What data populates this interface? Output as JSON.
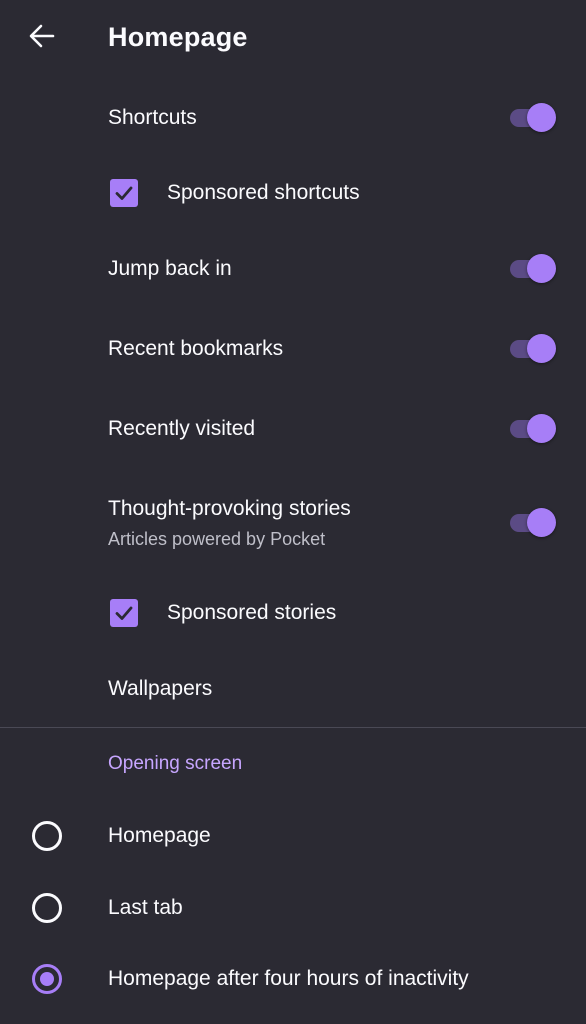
{
  "header": {
    "title": "Homepage",
    "back_icon": "arrow-left-icon"
  },
  "settings": {
    "shortcuts": {
      "label": "Shortcuts",
      "enabled": true
    },
    "sponsored_shortcuts": {
      "label": "Sponsored shortcuts",
      "checked": true
    },
    "jump_back_in": {
      "label": "Jump back in",
      "enabled": true
    },
    "recent_bookmarks": {
      "label": "Recent bookmarks",
      "enabled": true
    },
    "recently_visited": {
      "label": "Recently visited",
      "enabled": true
    },
    "stories": {
      "label": "Thought-provoking stories",
      "sublabel": "Articles powered by Pocket",
      "enabled": true
    },
    "sponsored_stories": {
      "label": "Sponsored stories",
      "checked": true
    },
    "wallpapers": {
      "label": "Wallpapers"
    }
  },
  "opening_screen": {
    "header": "Opening screen",
    "options": [
      {
        "label": "Homepage",
        "selected": false
      },
      {
        "label": "Last tab",
        "selected": false
      },
      {
        "label": "Homepage after four hours of inactivity",
        "selected": true
      }
    ]
  },
  "colors": {
    "background": "#2b2a33",
    "accent": "#a77ef7",
    "accent_track": "#5b4b85",
    "section_header": "#c7a6ff",
    "text": "#fbfbfe",
    "secondary_text": "#bfbfc9"
  }
}
